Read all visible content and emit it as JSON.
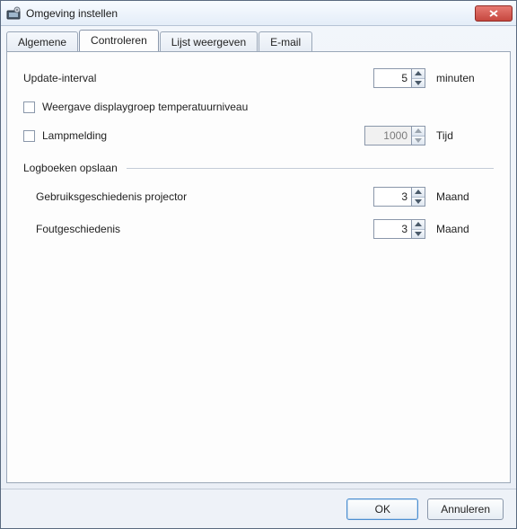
{
  "window": {
    "title": "Omgeving instellen"
  },
  "tabs": [
    {
      "id": "general",
      "label": "Algemene",
      "active": false
    },
    {
      "id": "monitor",
      "label": "Controleren",
      "active": true
    },
    {
      "id": "list",
      "label": "Lijst weergeven",
      "active": false
    },
    {
      "id": "email",
      "label": "E-mail",
      "active": false
    }
  ],
  "monitor": {
    "update_interval": {
      "label": "Update-interval",
      "value": "5",
      "unit": "minuten"
    },
    "display_group": {
      "label": "Weergave displaygroep temperatuurniveau",
      "checked": false
    },
    "lamp_notice": {
      "label": "Lampmelding",
      "checked": false,
      "value": "1000",
      "unit": "Tijd"
    },
    "logs": {
      "title": "Logboeken opslaan",
      "usage": {
        "label": "Gebruiksgeschiedenis projector",
        "value": "3",
        "unit": "Maand"
      },
      "errors": {
        "label": "Foutgeschiedenis",
        "value": "3",
        "unit": "Maand"
      }
    }
  },
  "buttons": {
    "ok": "OK",
    "cancel": "Annuleren"
  }
}
